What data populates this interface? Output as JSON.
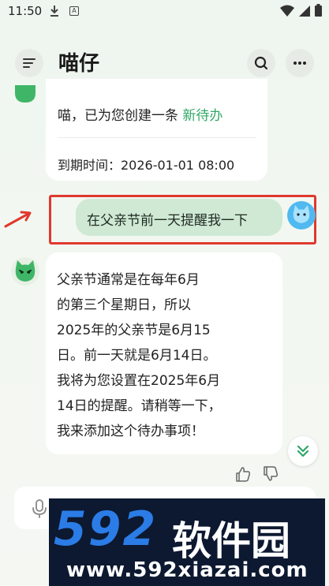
{
  "status_bar": {
    "time": "11:50",
    "a_badge": "A",
    "icons": [
      "download-icon",
      "a-badge-icon",
      "wifi-icon",
      "signal-icon",
      "battery-icon"
    ]
  },
  "header": {
    "title": "喵仔",
    "icons": [
      "menu-icon",
      "search-icon",
      "more-icon"
    ]
  },
  "messages": {
    "bot_confirm": {
      "text": "喵，已为您创建一条 ",
      "link": "新待办",
      "due": "到期时间：2026-01-01 08:00"
    },
    "user": {
      "text": "在父亲节前一天提醒我一下"
    },
    "bot_reply": {
      "lines": [
        "父亲节通常是在每年6月",
        "的第三个星期日，所以",
        "2025年的父亲节是6月15",
        "日。前一天就是6月14日。",
        "我将为您设置在2025年6月",
        "14日的提醒。请稍等一下，",
        "我来添加这个待办事项！"
      ]
    }
  },
  "colors": {
    "accent_green": "#2fa766",
    "user_bubble": "#cfe9d4",
    "highlight": "#e0382e",
    "watermark_blue": "#2b7ce6"
  },
  "watermark": {
    "logo": "592",
    "cn": "软件园",
    "url": "www.592xiazai.com"
  }
}
